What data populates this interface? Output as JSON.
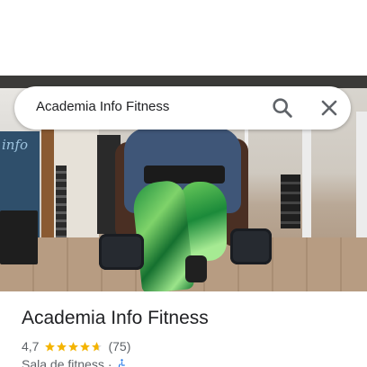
{
  "search": {
    "query": "Academia Info Fitness",
    "search_icon": "search-icon",
    "close_icon": "close-icon"
  },
  "photo": {
    "logo_text": "info"
  },
  "place": {
    "title": "Academia Info Fitness",
    "rating": "4,7",
    "rating_value": 4.7,
    "stars_max": 5,
    "star_color": "#f4b400",
    "review_count": "(75)",
    "category": "Sala de fitness",
    "separator": "·",
    "accessibility_icon": "wheelchair-accessible-icon",
    "accessibility_color": "#1a73e8"
  }
}
